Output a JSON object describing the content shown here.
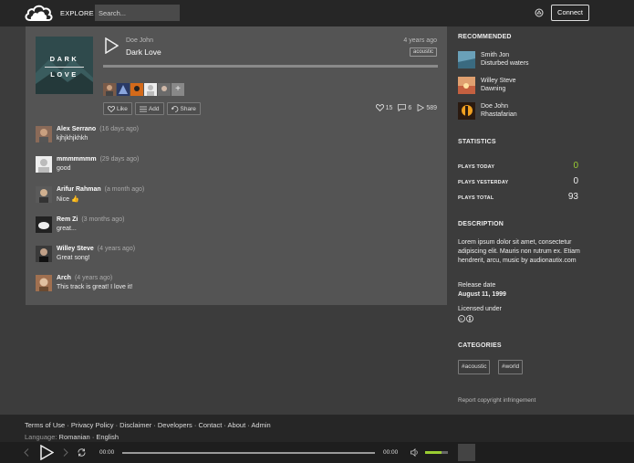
{
  "header": {
    "explore": "EXPLORE",
    "search_placeholder": "Search...",
    "connect": "Connect"
  },
  "track": {
    "cover_line1": "DARK",
    "cover_line2": "LOVE",
    "artist": "Doe John",
    "title": "Dark Love",
    "time_ago": "4 years ago",
    "genre": "acoustic",
    "actions": {
      "like": "Like",
      "add": "Add",
      "share": "Share"
    },
    "likes": "15",
    "comments": "6",
    "plays": "589"
  },
  "comments": [
    {
      "name": "Alex Serrano",
      "ago": "(16 days ago)",
      "text": "kjhjkhjkhkh"
    },
    {
      "name": "mmmmmmm",
      "ago": "(29 days ago)",
      "text": "good"
    },
    {
      "name": "Arifur Rahman",
      "ago": "(a month ago)",
      "text": "Nice 👍"
    },
    {
      "name": "Rem Zi",
      "ago": "(3 months ago)",
      "text": "great..."
    },
    {
      "name": "Willey Steve",
      "ago": "(4 years ago)",
      "text": "Great song!"
    },
    {
      "name": "Arch",
      "ago": "(4 years ago)",
      "text": "This track is great! I love it!"
    }
  ],
  "sidebar": {
    "recommended_heading": "RECOMMENDED",
    "recommended": [
      {
        "artist": "Smith Jon",
        "title": "Disturbed waters"
      },
      {
        "artist": "Willey Steve",
        "title": "Dawning"
      },
      {
        "artist": "Doe John",
        "title": "Rhastafarian"
      }
    ],
    "statistics_heading": "STATISTICS",
    "stats": [
      {
        "label": "PLAYS TODAY",
        "value": "0"
      },
      {
        "label": "PLAYS YESTERDAY",
        "value": "0"
      },
      {
        "label": "PLAYS TOTAL",
        "value": "93"
      }
    ],
    "description_heading": "DESCRIPTION",
    "description": "Lorem ipsum dolor sit amet, consectetur adipiscing elit. Mauris non rutrum ex. Etiam hendrerit, arcu, music by audionautix.com",
    "release_label": "Release date",
    "release_date": "August 11, 1999",
    "license_label": "Licensed under",
    "categories_heading": "CATEGORIES",
    "categories": [
      "#acoustic",
      "#world"
    ],
    "report": "Report copyright infringement"
  },
  "footer": {
    "links": "Terms of Use · Privacy Policy · Disclaimer · Developers · Contact · About · Admin",
    "language_label": "Language:",
    "languages": "Romanian · English"
  },
  "player": {
    "current": "00:00",
    "total": "00:00",
    "volume": 0.7
  },
  "colors": {
    "accent_green": "#9acd32",
    "topbar": "#262626",
    "card": "#545454"
  }
}
